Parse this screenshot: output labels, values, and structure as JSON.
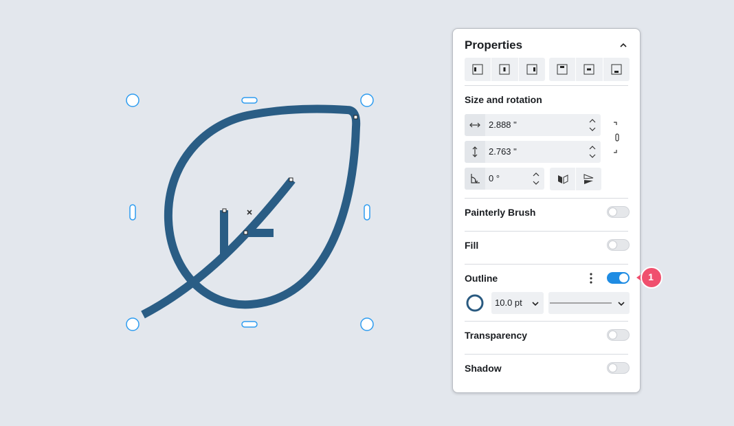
{
  "panel": {
    "title": "Properties",
    "sections": {
      "size_rotation": {
        "title": "Size and rotation",
        "width": "2.888 \"",
        "height": "2.763 \"",
        "rotation": "0 °"
      },
      "painterly_brush": {
        "title": "Painterly Brush",
        "enabled": false
      },
      "fill": {
        "title": "Fill",
        "enabled": false
      },
      "outline": {
        "title": "Outline",
        "enabled": true,
        "width": "10.0 pt",
        "color": "#2a5a80"
      },
      "transparency": {
        "title": "Transparency",
        "enabled": false
      },
      "shadow": {
        "title": "Shadow",
        "enabled": false
      }
    }
  },
  "badge": {
    "number": "1",
    "color": "#f0506e"
  },
  "colors": {
    "shape_stroke": "#2a5d85",
    "handle": "#2d9cf0",
    "toggle_on": "#1f8ce3"
  },
  "icons": {
    "collapse": "chevron-up-icon",
    "align": [
      "align-left-icon",
      "align-center-horizontal-icon",
      "align-right-icon",
      "align-top-icon",
      "align-center-vertical-icon",
      "align-bottom-icon"
    ],
    "width": "width-arrow-icon",
    "height": "height-arrow-icon",
    "rotation": "rotation-angle-icon",
    "lock": "link-icon",
    "mirror": [
      "mirror-horizontal-icon",
      "mirror-vertical-icon"
    ],
    "more": "kebab-icon"
  }
}
